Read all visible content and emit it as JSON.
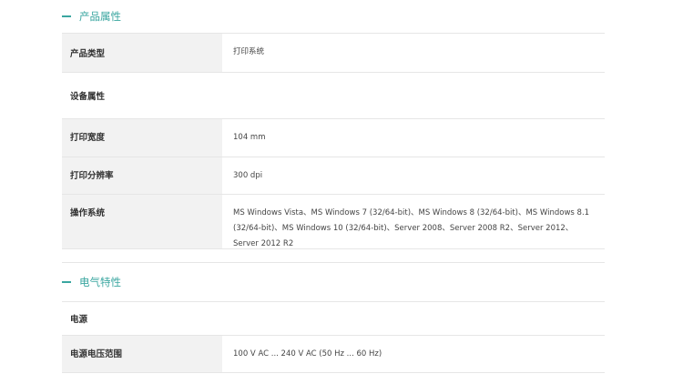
{
  "sections": {
    "product": {
      "title": "产品属性",
      "rows": [
        {
          "key": "产品类型",
          "value": "打印系统"
        }
      ]
    },
    "device_group": "设备属性",
    "device_rows": [
      {
        "key": "打印宽度",
        "value": "104 mm"
      },
      {
        "key": "打印分辨率",
        "value": "300 dpi"
      },
      {
        "key": "操作系统",
        "value": "MS Windows Vista、MS Windows 7 (32/64-bit)、MS Windows 8 (32/64-bit)、MS Windows 8.1 (32/64-bit)、MS Windows 10 (32/64-bit)、Server 2008、Server 2008 R2、Server 2012、Server 2012 R2"
      }
    ],
    "electrical": {
      "title": "电气特性",
      "group": "电源",
      "rows": [
        {
          "key": "电源电压范围",
          "value": "100 V AC ... 240 V AC (50 Hz ... 60 Hz)"
        }
      ]
    }
  },
  "colors": {
    "accent": "#3aa6a0",
    "key_bg": "#f2f2f2",
    "border": "#e6e6e6"
  },
  "icons": {
    "collapse": "minus-icon"
  }
}
